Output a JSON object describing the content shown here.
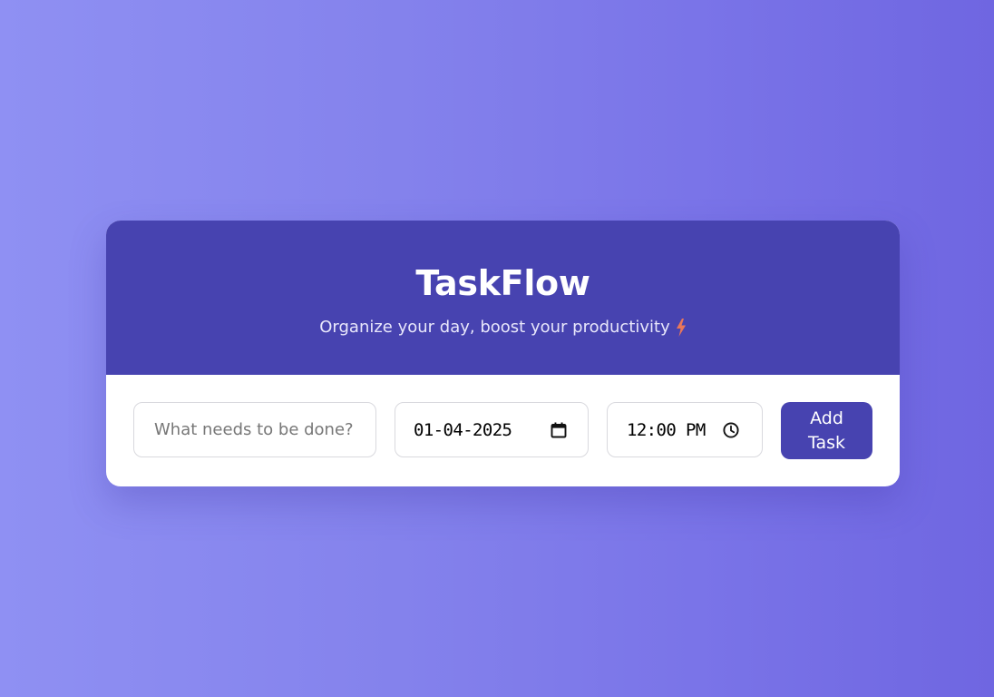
{
  "app": {
    "title": "TaskFlow",
    "subtitle": "Organize your day, boost your productivity",
    "subtitle_icon": "lightning-bolt-icon"
  },
  "form": {
    "task_input": {
      "value": "",
      "placeholder": "What needs to be done?"
    },
    "date_input": {
      "value": "01-04-2025",
      "icon": "calendar-icon"
    },
    "time_input": {
      "value": "12:00 PM",
      "icon": "clock-icon"
    },
    "add_button_label": "Add Task"
  },
  "colors": {
    "accent": "#4743b0",
    "background_gradient_start": "#8f90f3",
    "background_gradient_end": "#6f66e1",
    "bolt": "#e8775a"
  }
}
